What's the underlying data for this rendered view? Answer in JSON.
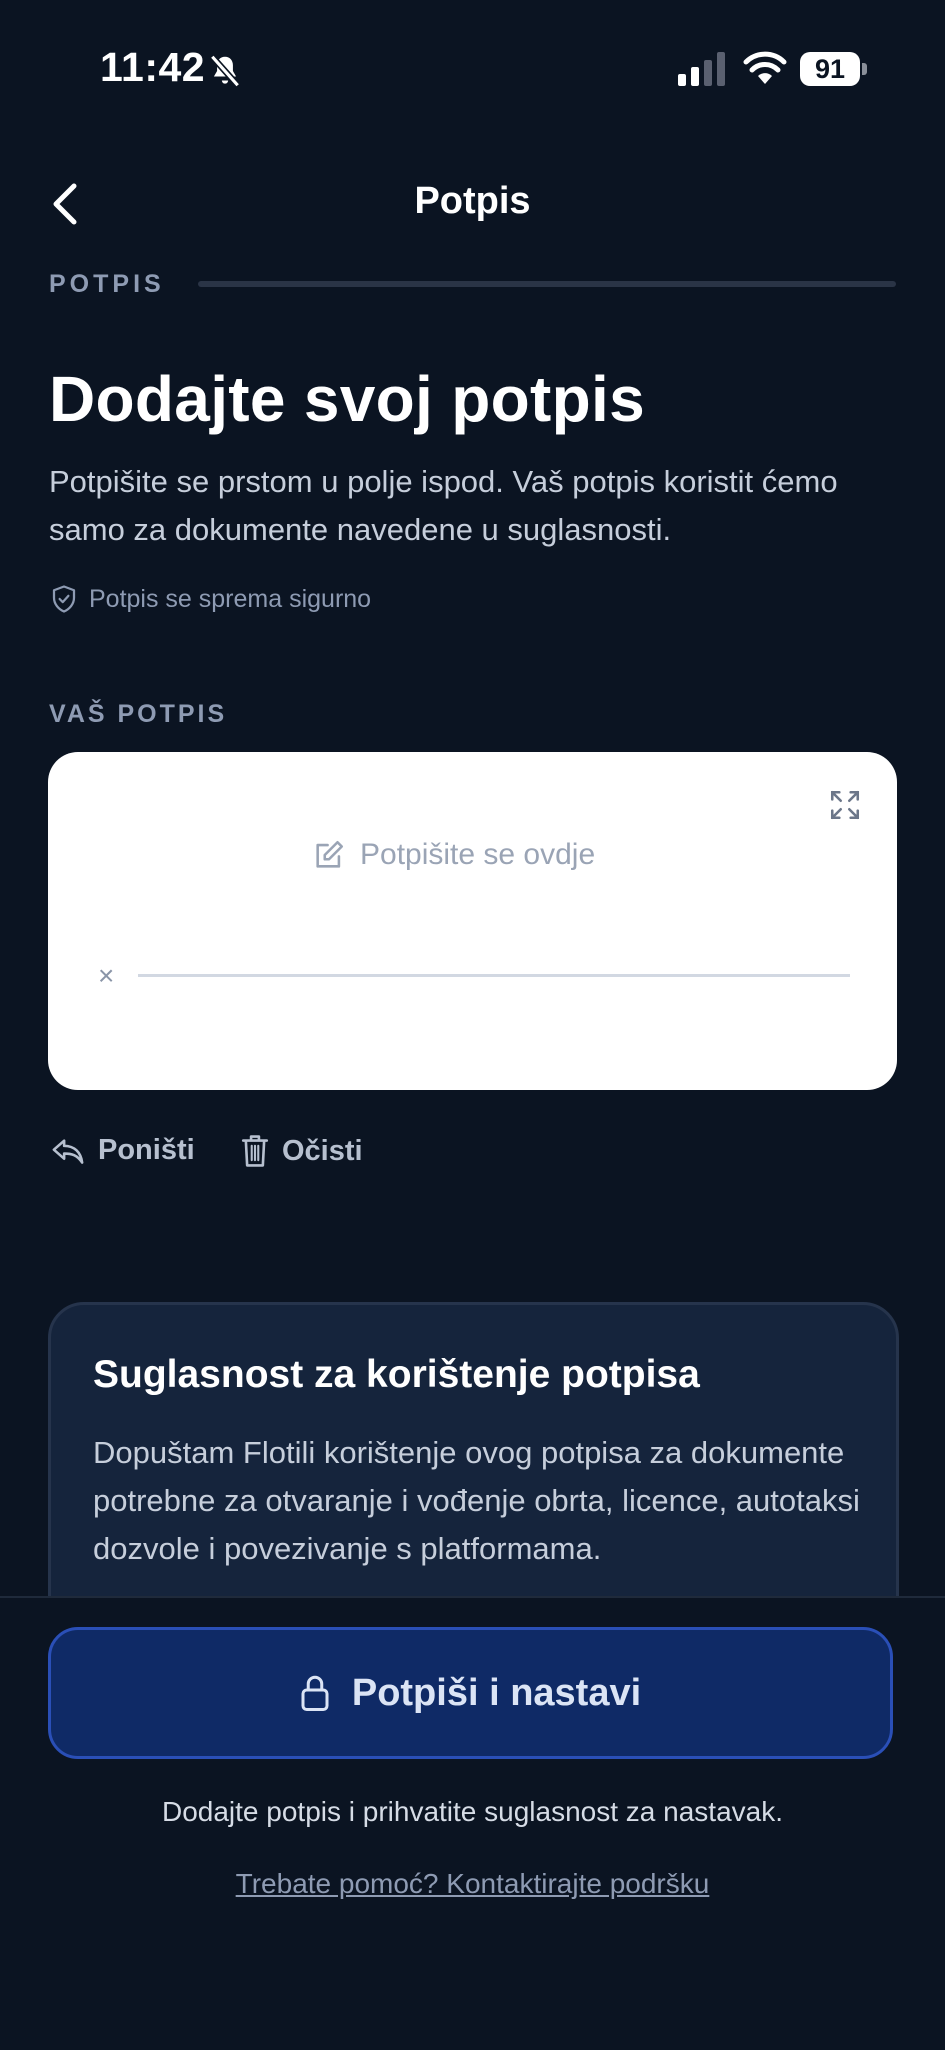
{
  "status_bar": {
    "time": "11:42",
    "battery": "91"
  },
  "header": {
    "title": "Potpis"
  },
  "progress": {
    "label": "POTPIS"
  },
  "main": {
    "heading": "Dodajte svoj potpis",
    "description": "Potpišite se prstom u polje ispod. Vaš potpis koristit ćemo samo za dokumente navedene u suglasnosti.",
    "secure_note": "Potpis se sprema sigurno"
  },
  "signature": {
    "label": "VAŠ POTPIS",
    "placeholder": "Potpišite se ovdje",
    "x_mark": "×",
    "undo_label": "Poništi",
    "clear_label": "Očisti"
  },
  "consent": {
    "title": "Suglasnost za korištenje potpisa",
    "text": "Dopuštam Flotili korištenje ovog potpisa za dokumente potrebne za otvaranje i vođenje obrta, licence, autotaksi dozvole i povezivanje s platformama."
  },
  "footer": {
    "cta_label": "Potpiši i nastavi",
    "hint": "Dodajte potpis i prihvatite suglasnost za nastavak.",
    "help_link": "Trebate pomoć? Kontaktirajte podršku"
  },
  "colors": {
    "background": "#0b1422",
    "cta": "#0f2a66",
    "cta_border": "#2a4fb7",
    "muted": "#8e9bb3"
  },
  "icons": [
    "bell-slash-icon",
    "signal-icon",
    "wifi-icon",
    "battery-icon",
    "chevron-left-icon",
    "shield-check-icon",
    "expand-icon",
    "edit-icon",
    "undo-icon",
    "trash-icon",
    "lock-icon"
  ]
}
